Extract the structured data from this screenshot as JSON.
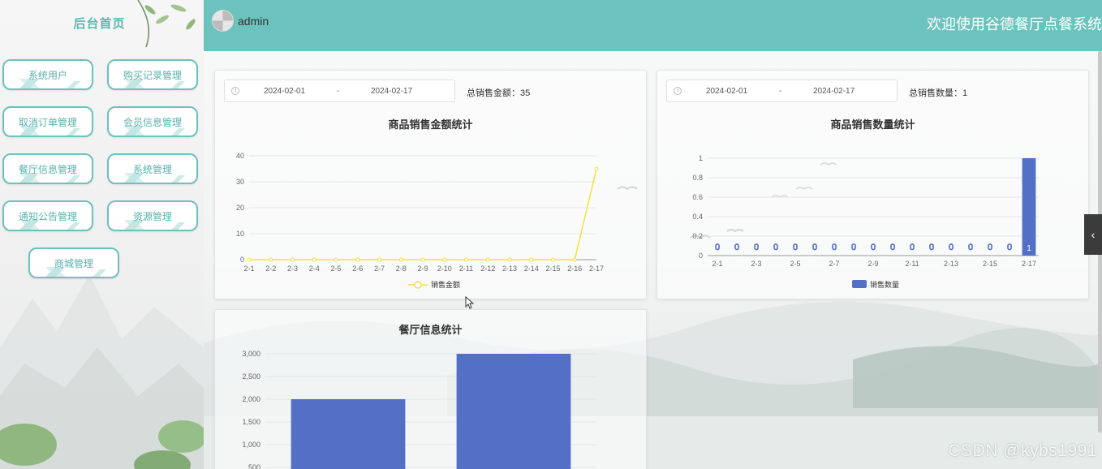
{
  "sidebar": {
    "title": "后台首页",
    "items": [
      {
        "label": "系统用户"
      },
      {
        "label": "购买记录管理"
      },
      {
        "label": "取消订单管理"
      },
      {
        "label": "会员信息管理"
      },
      {
        "label": "餐厅信息管理"
      },
      {
        "label": "系统管理"
      },
      {
        "label": "通知公告管理"
      },
      {
        "label": "资源管理"
      },
      {
        "label": "商城管理"
      }
    ]
  },
  "header": {
    "username": "admin",
    "welcome": "欢迎使用谷德餐厅点餐系统",
    "accent_color": "#6cc2bd"
  },
  "sales_amount": {
    "start_date": "2024-02-01",
    "separator": "-",
    "end_date": "2024-02-17",
    "total_label": "总销售金额：35"
  },
  "sales_count": {
    "start_date": "2024-02-01",
    "separator": "-",
    "end_date": "2024-02-17",
    "total_label": "总销售数量：1"
  },
  "watermark": "CSDN @kybs1991",
  "chart_data": [
    {
      "type": "line",
      "title": "商品销售金额统计",
      "categories": [
        "2-1",
        "2-2",
        "2-3",
        "2-4",
        "2-5",
        "2-6",
        "2-7",
        "2-8",
        "2-9",
        "2-10",
        "2-11",
        "2-12",
        "2-13",
        "2-14",
        "2-15",
        "2-16",
        "2-17"
      ],
      "series": [
        {
          "name": "销售金额",
          "values": [
            0,
            0,
            0,
            0,
            0,
            0,
            0,
            0,
            0,
            0,
            0,
            0,
            0,
            0,
            0,
            0,
            35
          ],
          "color": "#f5e23b"
        }
      ],
      "yticks": [
        "0",
        "10",
        "20",
        "30",
        "40"
      ],
      "ylim": [
        0,
        40
      ],
      "legend": "bottom",
      "grid": true
    },
    {
      "type": "bar",
      "title": "商品销售数量统计",
      "categories": [
        "2-1",
        "2-2",
        "2-3",
        "2-4",
        "2-5",
        "2-6",
        "2-7",
        "2-8",
        "2-9",
        "2-10",
        "2-11",
        "2-12",
        "2-13",
        "2-14",
        "2-15",
        "2-16",
        "2-17"
      ],
      "x_tick_labels": [
        "2-1",
        "2-3",
        "2-5",
        "2-7",
        "2-9",
        "2-11",
        "2-13",
        "2-15",
        "2-17"
      ],
      "series": [
        {
          "name": "销售数量",
          "values": [
            0,
            0,
            0,
            0,
            0,
            0,
            0,
            0,
            0,
            0,
            0,
            0,
            0,
            0,
            0,
            0,
            1
          ],
          "color": "#5470c6"
        }
      ],
      "data_labels": [
        "0",
        "0",
        "0",
        "0",
        "0",
        "0",
        "0",
        "0",
        "0",
        "0",
        "0",
        "0",
        "0",
        "0",
        "0",
        "0",
        "1"
      ],
      "yticks": [
        "0",
        "0.2",
        "0.4",
        "0.6",
        "0.8",
        "1"
      ],
      "ylim": [
        0,
        1
      ],
      "legend": "bottom",
      "grid": true
    },
    {
      "type": "bar",
      "title": "餐厅信息统计",
      "series": [
        {
          "values": [
            2000,
            3000
          ],
          "color": "#5470c6"
        }
      ],
      "yticks": [
        "500",
        "1,000",
        "1,500",
        "2,000",
        "2,500",
        "3,000"
      ],
      "ylim": [
        0,
        3000
      ],
      "grid": true
    }
  ]
}
